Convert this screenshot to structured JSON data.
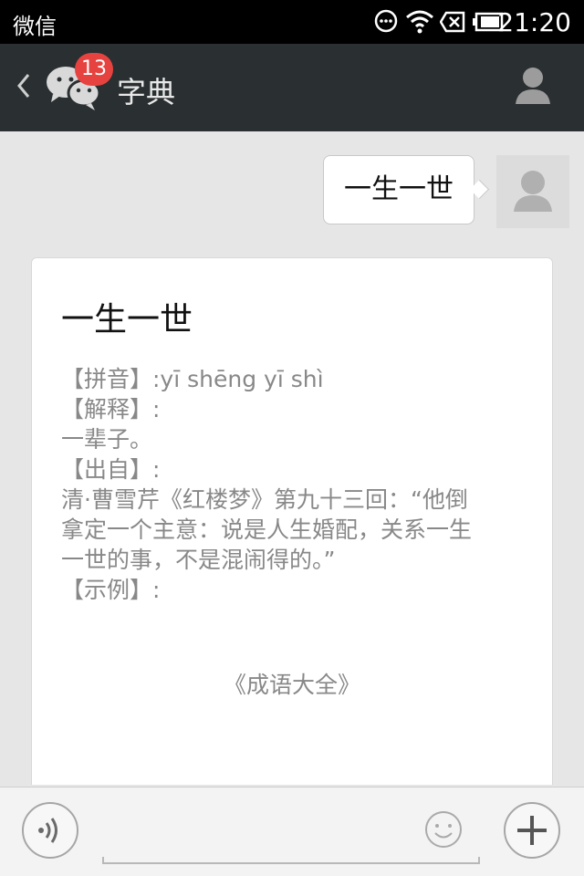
{
  "status_bar": {
    "app_name": "微信",
    "time": "21:20",
    "icons": [
      "message-icon",
      "wifi-icon",
      "no-sim-icon",
      "battery-icon"
    ]
  },
  "header": {
    "back_icon": "back-chevron-icon",
    "chats_icon": "wechat-chats-icon",
    "unread_count": "13",
    "title": "字典",
    "profile_icon": "person-icon"
  },
  "messages": [
    {
      "direction": "sent",
      "text": "一生一世",
      "avatar_icon": "person-icon"
    },
    {
      "direction": "received",
      "card": {
        "title": "一生一世",
        "lines": [
          "【拼音】:yī  shēng  yī  shì",
          "【解释】:",
          "一辈子。",
          "【出自】:",
          "清·曹雪芹《红楼梦》第九十三回：“他倒",
          "拿定一个主意：说是人生婚配，关系一生",
          "一世的事，不是混闹得的。”",
          "【示例】:"
        ],
        "source": "《成语大全》"
      }
    }
  ],
  "input_bar": {
    "voice_icon": "voice-input-icon",
    "emoji_icon": "emoji-icon",
    "plus_icon": "plus-icon"
  },
  "colors": {
    "status_bar": "#000000",
    "header_bg": "#2a2f31",
    "chat_bg": "#e6e6e6",
    "badge": "#e64340",
    "card_text": "#888888"
  }
}
